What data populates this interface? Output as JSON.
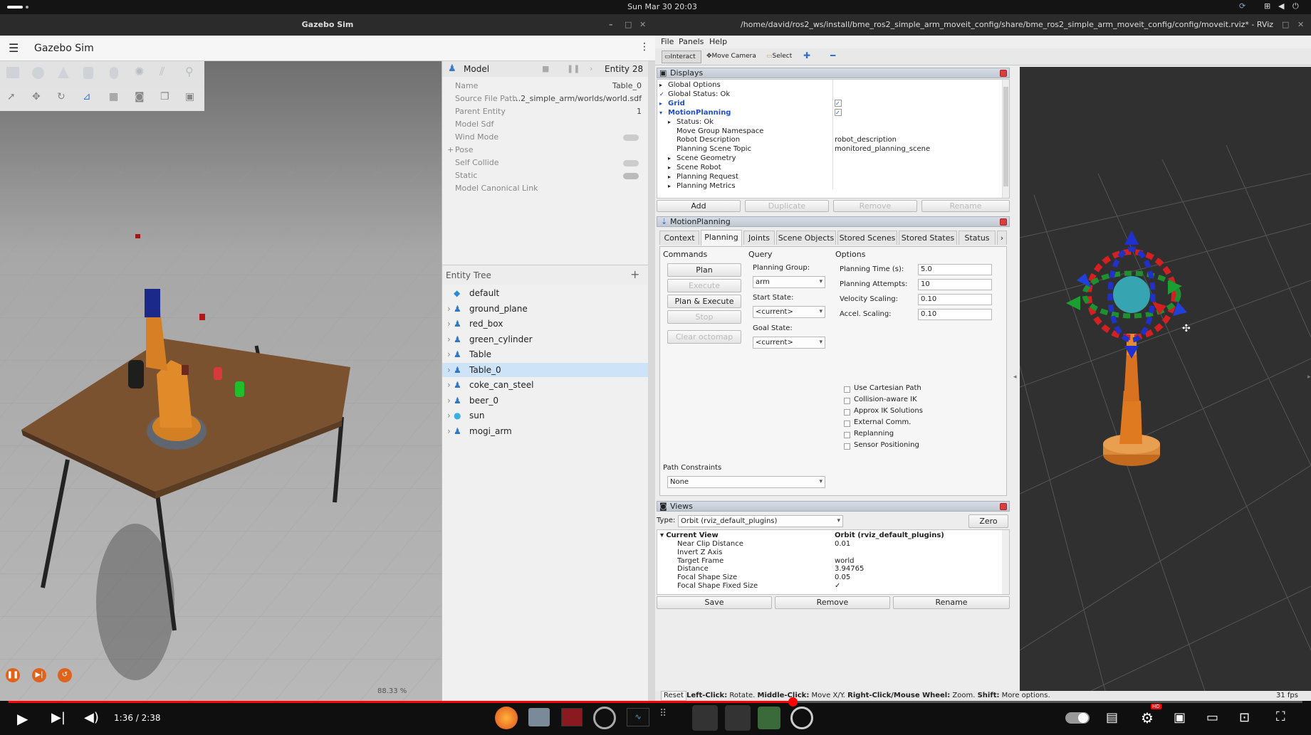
{
  "topbar": {
    "clock": "Sun Mar 30  20:03"
  },
  "gazebo": {
    "window_title": "Gazebo Sim",
    "app_title": "Gazebo Sim",
    "component_inspector": {
      "header": "Model",
      "entity": "Entity 28",
      "properties": [
        {
          "name": "Name",
          "value": "Table_0"
        },
        {
          "name": "Source File Path",
          "value": "...2_simple_arm/worlds/world.sdf"
        },
        {
          "name": "Parent Entity",
          "value": "1"
        },
        {
          "name": "Model Sdf",
          "value": ""
        },
        {
          "name": "Wind Mode",
          "value": ""
        },
        {
          "name": "Pose",
          "value": ""
        },
        {
          "name": "Self Collide",
          "value": ""
        },
        {
          "name": "Static",
          "value": ""
        },
        {
          "name": "Model Canonical Link",
          "value": ""
        }
      ]
    },
    "entity_tree": {
      "title": "Entity Tree",
      "add_icon": "plus-icon",
      "items": [
        "default",
        "ground_plane",
        "red_box",
        "green_cylinder",
        "Table",
        "Table_0",
        "coke_can_steel",
        "beer_0",
        "sun",
        "mogi_arm"
      ],
      "selected": "Table_0"
    },
    "rtf": "88.33 %"
  },
  "rviz": {
    "window_title": "/home/david/ros2_ws/install/bme_ros2_simple_arm_moveit_config/share/bme_ros2_simple_arm_moveit_config/config/moveit.rviz* - RViz",
    "menu": [
      "File",
      "Panels",
      "Help"
    ],
    "toolbar": {
      "interact": "Interact",
      "move_camera": "Move Camera",
      "select": "Select"
    },
    "displays": {
      "title": "Displays",
      "rows": [
        {
          "label": "Global Options",
          "value": ""
        },
        {
          "label": "Global Status: Ok",
          "value": ""
        },
        {
          "label": "Grid",
          "value": "✓"
        },
        {
          "label": "MotionPlanning",
          "value": "✓"
        },
        {
          "label": "Status: Ok",
          "value": ""
        },
        {
          "label": "Move Group Namespace",
          "value": ""
        },
        {
          "label": "Robot Description",
          "value": "robot_description"
        },
        {
          "label": "Planning Scene Topic",
          "value": "monitored_planning_scene"
        },
        {
          "label": "Scene Geometry",
          "value": ""
        },
        {
          "label": "Scene Robot",
          "value": ""
        },
        {
          "label": "Planning Request",
          "value": ""
        },
        {
          "label": "Planning Metrics",
          "value": ""
        }
      ],
      "buttons": [
        "Add",
        "Duplicate",
        "Remove",
        "Rename"
      ]
    },
    "motion_planning": {
      "title": "MotionPlanning",
      "tabs": [
        "Context",
        "Planning",
        "Joints",
        "Scene Objects",
        "Stored Scenes",
        "Stored States",
        "Status"
      ],
      "active_tab": "Planning",
      "commands_label": "Commands",
      "commands": [
        "Plan",
        "Execute",
        "Plan & Execute",
        "Stop",
        "Clear octomap"
      ],
      "query_label": "Query",
      "planning_group_label": "Planning Group:",
      "planning_group": "arm",
      "start_state_label": "Start State:",
      "start_state": "<current>",
      "goal_state_label": "Goal State:",
      "goal_state": "<current>",
      "options_label": "Options",
      "options": [
        {
          "label": "Planning Time (s):",
          "value": "5.0"
        },
        {
          "label": "Planning Attempts:",
          "value": "10"
        },
        {
          "label": "Velocity Scaling:",
          "value": "0.10"
        },
        {
          "label": "Accel. Scaling:",
          "value": "0.10"
        }
      ],
      "checkboxes": [
        "Use Cartesian Path",
        "Collision-aware IK",
        "Approx IK Solutions",
        "External Comm.",
        "Replanning",
        "Sensor Positioning"
      ],
      "path_constraints_label": "Path Constraints",
      "path_constraints": "None"
    },
    "views": {
      "title": "Views",
      "type_label": "Type:",
      "type": "Orbit (rviz_default_plugins)",
      "zero": "Zero",
      "current_view": "Current View",
      "current_view_value": "Orbit (rviz_default_plugins)",
      "rows": [
        {
          "label": "Near Clip Distance",
          "value": "0.01"
        },
        {
          "label": "Invert Z Axis",
          "value": ""
        },
        {
          "label": "Target Frame",
          "value": "world"
        },
        {
          "label": "Distance",
          "value": "3.94765"
        },
        {
          "label": "Focal Shape Size",
          "value": "0.05"
        },
        {
          "label": "Focal Shape Fixed Size",
          "value": "✓"
        }
      ],
      "buttons": [
        "Save",
        "Remove",
        "Rename"
      ]
    },
    "status": {
      "reset": "Reset",
      "hint_b1": "Left-Click:",
      "hint_t1": " Rotate. ",
      "hint_b2": "Middle-Click:",
      "hint_t2": " Move X/Y. ",
      "hint_b3": "Right-Click/Mouse Wheel:",
      "hint_t3": " Zoom. ",
      "hint_b4": "Shift:",
      "hint_t4": " More options.",
      "fps": "31 fps"
    }
  },
  "player": {
    "time": "1:36 / 2:38",
    "progress": 0.606,
    "hd_badge": "HD"
  }
}
